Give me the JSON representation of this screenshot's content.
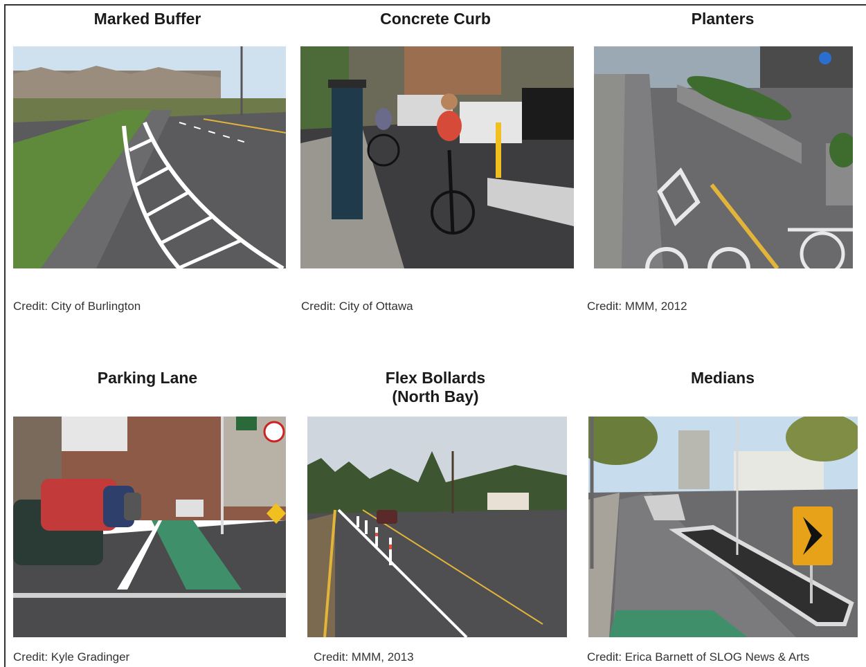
{
  "panels": [
    {
      "title": "Marked Buffer",
      "credit": "Credit: City of Burlington"
    },
    {
      "title": "Concrete Curb",
      "credit": "Credit: City of Ottawa"
    },
    {
      "title": "Planters",
      "credit": "Credit: MMM, 2012"
    },
    {
      "title": "Parking Lane",
      "credit": "Credit: Kyle Gradinger"
    },
    {
      "title": "Flex Bollards\n(North Bay)",
      "credit": "Credit: MMM, 2013"
    },
    {
      "title": "Medians",
      "credit": "Credit: Erica Barnett of SLOG News & Arts"
    }
  ],
  "colors": {
    "sky": "#cfe0ef",
    "asphalt": "#4a4a4c",
    "bike_lane_green": "#3f8f6a",
    "grass": "#5f8a3c",
    "marking_white": "#ffffff",
    "marking_yellow": "#e2b53a"
  }
}
